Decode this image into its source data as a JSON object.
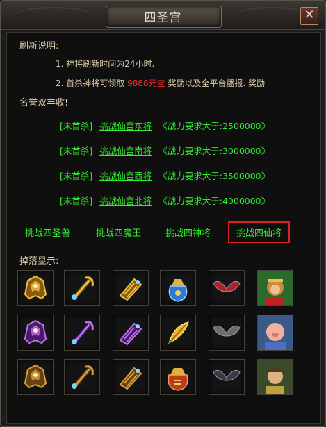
{
  "window": {
    "title": "四圣宫",
    "close_glyph": "✕"
  },
  "description": {
    "title": "刷新说明:",
    "line1": "1. 神将刷新时间为24小时.",
    "line2_prefix": "2. 首杀神将可领取",
    "line2_highlight": "9888元宝",
    "line2_suffix": "奖励以及全平台播报. 奖励",
    "line3": "名誉双丰收!"
  },
  "tasks": [
    {
      "status": "[未首杀]",
      "link": "挑战仙宫东将",
      "requirement": "《战力要求大于:2500000》"
    },
    {
      "status": "[未首杀]",
      "link": "挑战仙宫南将",
      "requirement": "《战力要求大于:3000000》"
    },
    {
      "status": "[未首杀]",
      "link": "挑战仙宫西将",
      "requirement": "《战力要求大于:3500000》"
    },
    {
      "status": "[未首杀]",
      "link": "挑战仙宫北将",
      "requirement": "《战力要求大于:4000000》"
    }
  ],
  "tabs": [
    {
      "label": "挑战四圣兽"
    },
    {
      "label": "挑战四魔王"
    },
    {
      "label": "挑战四神将"
    },
    {
      "label": "挑战四仙将",
      "active": true
    }
  ],
  "drops": {
    "title": "掉落显示:",
    "rows": [
      [
        "gold-helmet-icon",
        "gold-sword-icon",
        "gold-bracer-icon",
        "blue-pouch-icon",
        "red-wings-icon",
        "monkey-portrait-icon"
      ],
      [
        "purple-helmet-icon",
        "purple-sword-icon",
        "purple-bracer-icon",
        "golden-feather-icon",
        "dark-wings-icon",
        "pig-portrait-icon"
      ],
      [
        "bronze-helmet-icon",
        "bronze-sword-icon",
        "bronze-bracer-icon",
        "red-pouch-icon",
        "shadow-wings-icon",
        "monk-portrait-icon"
      ]
    ]
  },
  "colors": {
    "link_green": "#33ee33",
    "highlight_red": "#ff2a2a",
    "text_beige": "#d9c9a6",
    "active_tab_border": "#e02020"
  }
}
